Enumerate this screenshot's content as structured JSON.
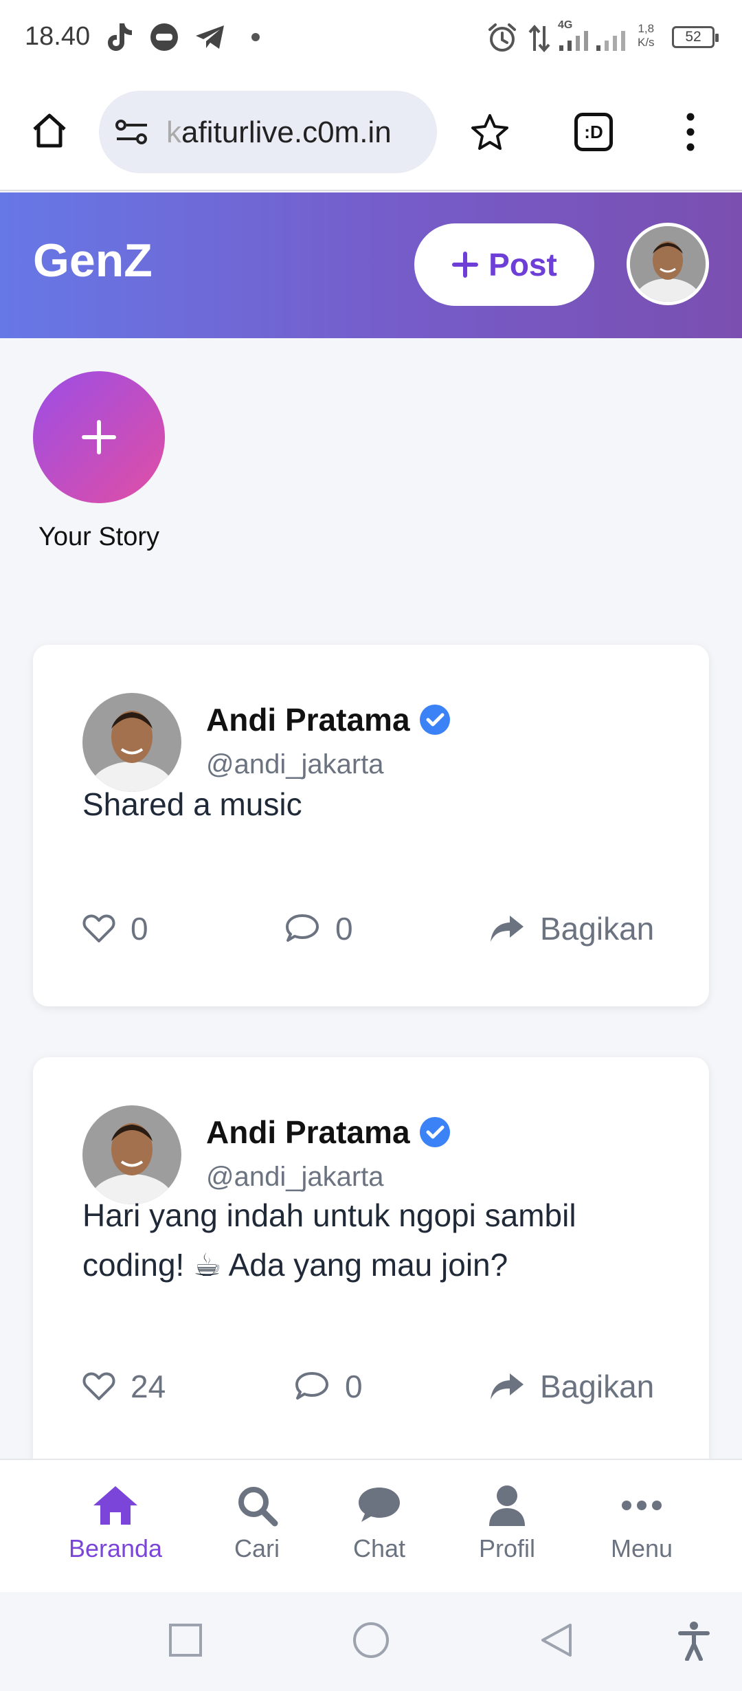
{
  "status_bar": {
    "time": "18.40",
    "network": "4G",
    "speed_value": "1,8",
    "speed_unit": "K/s",
    "battery": "52"
  },
  "browser": {
    "url_fade": "k",
    "url": "afiturlive.c0m.in",
    "tab_switcher_label": ":D"
  },
  "app": {
    "brand": "GenZ",
    "post_button_label": "Post"
  },
  "stories": {
    "your_story_label": "Your Story"
  },
  "posts": [
    {
      "author_name": "Andi Pratama",
      "author_handle": "@andi_jakarta",
      "text": "Shared a music",
      "likes": "0",
      "comments": "0",
      "share_label": "Bagikan"
    },
    {
      "author_name": "Andi Pratama",
      "author_handle": "@andi_jakarta",
      "text": "Hari yang indah untuk ngopi sambil coding! ☕ Ada yang mau join?",
      "likes": "24",
      "comments": "0",
      "share_label": "Bagikan"
    }
  ],
  "bottom_nav": {
    "items": [
      {
        "label": "Beranda",
        "icon": "home-icon",
        "active": true
      },
      {
        "label": "Cari",
        "icon": "search-icon",
        "active": false
      },
      {
        "label": "Chat",
        "icon": "chat-icon",
        "active": false
      },
      {
        "label": "Profil",
        "icon": "user-icon",
        "active": false
      },
      {
        "label": "Menu",
        "icon": "ellipsis-icon",
        "active": false
      }
    ]
  },
  "colors": {
    "accent": "#7b45d9",
    "header_gradient_start": "#6678e6",
    "header_gradient_end": "#7a4fb0",
    "verified": "#3b82f6"
  }
}
